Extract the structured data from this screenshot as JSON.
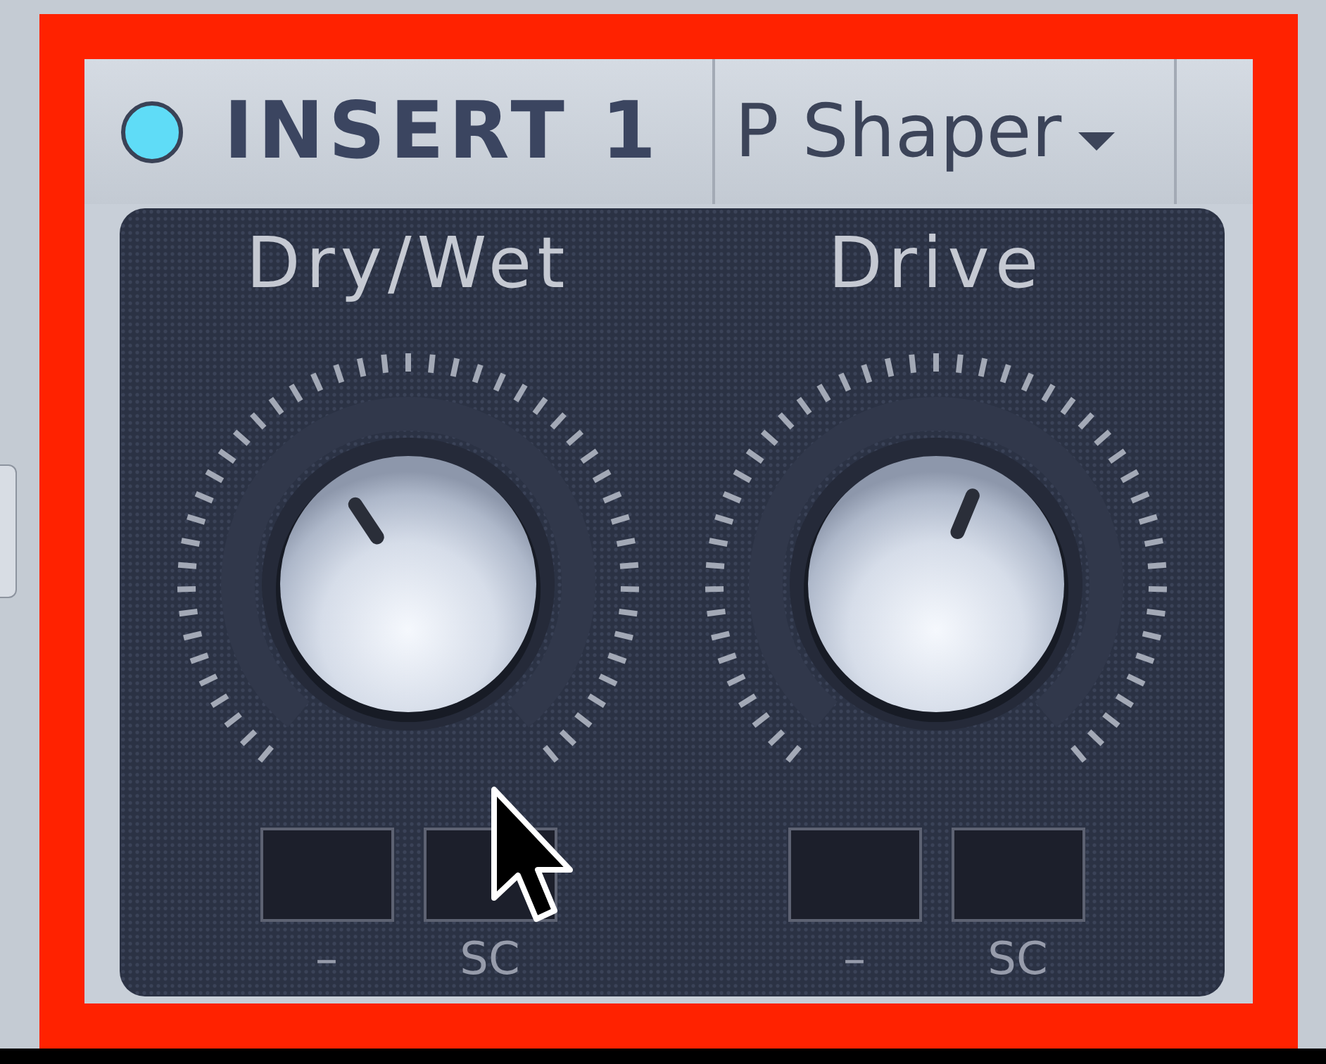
{
  "insert": {
    "led": {
      "on": true
    },
    "title": "INSERT 1",
    "effect": {
      "label": "P Shaper"
    }
  },
  "knobs": [
    {
      "label": "Dry/Wet",
      "level": 0.38,
      "slots": [
        {
          "label": "–"
        },
        {
          "label": "SC"
        }
      ]
    },
    {
      "label": "Drive",
      "level": 0.58,
      "slots": [
        {
          "label": "–"
        },
        {
          "label": "SC"
        }
      ]
    }
  ]
}
